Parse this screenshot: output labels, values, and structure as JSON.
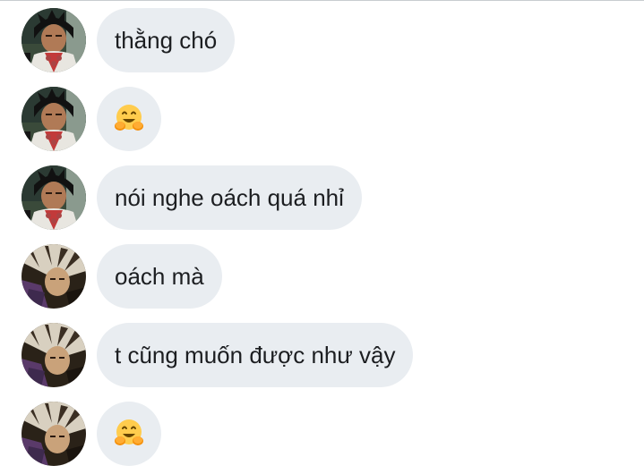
{
  "messages": [
    {
      "author": "user-a",
      "text": "thằng chó"
    },
    {
      "author": "user-a",
      "emoji": "hugging-face-emoji"
    },
    {
      "author": "user-a",
      "text": "nói nghe oách quá nhỉ"
    },
    {
      "author": "user-b",
      "text": "oách mà"
    },
    {
      "author": "user-b",
      "text": "t cũng muốn được như vậy"
    },
    {
      "author": "user-b",
      "emoji": "hugging-face-emoji"
    }
  ],
  "colors": {
    "bubble_background": "#e9edf1",
    "text": "#1c1e21",
    "page_background": "#ffffff",
    "divider": "#c8ccd0"
  }
}
